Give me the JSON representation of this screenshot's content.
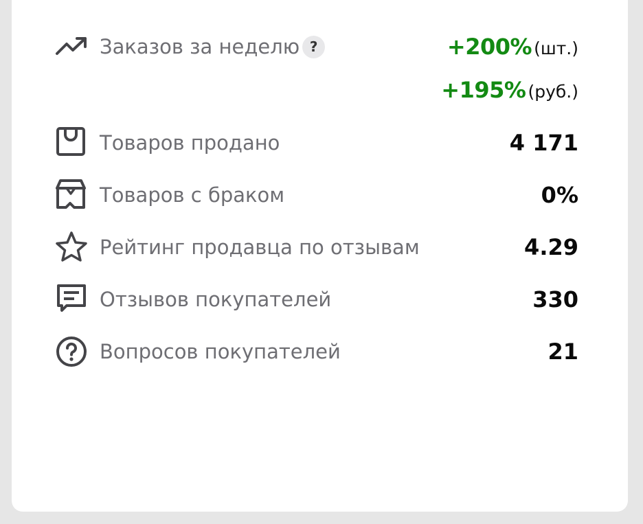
{
  "colors": {
    "background": "#e6e6e6",
    "card": "#ffffff",
    "label": "#6e6e73",
    "value": "#0a0a0a",
    "growth": "#138a13",
    "icon": "#444448"
  },
  "orders": {
    "label": "Заказов за неделю",
    "help": "?",
    "icon": "trending-up-icon",
    "pieces_change": "+200%",
    "pieces_unit": "(шт.)",
    "rubles_change": "+195%",
    "rubles_unit": "(руб.)"
  },
  "stats": [
    {
      "icon": "shopping-bag-icon",
      "label": "Товаров продано",
      "value": "4 171"
    },
    {
      "icon": "damaged-box-icon",
      "label": "Товаров с браком",
      "value": "0%"
    },
    {
      "icon": "star-icon",
      "label": "Рейтинг продавца по отзывам",
      "value": "4.29"
    },
    {
      "icon": "comment-icon",
      "label": "Отзывов покупателей",
      "value": "330"
    },
    {
      "icon": "question-circle-icon",
      "label": "Вопросов покупателей",
      "value": "21"
    }
  ]
}
